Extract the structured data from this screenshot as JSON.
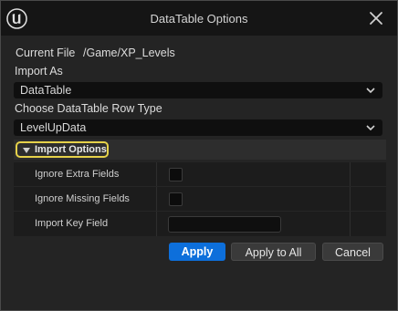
{
  "window": {
    "title": "DataTable Options",
    "icons": {
      "logo": "unreal-engine-logo-icon",
      "close": "close-icon"
    }
  },
  "current_file": {
    "label": "Current File",
    "value": "/Game/XP_Levels"
  },
  "import_as": {
    "label": "Import As",
    "selected": "DataTable"
  },
  "row_type": {
    "label": "Choose DataTable Row Type",
    "selected": "LevelUpData"
  },
  "import_options": {
    "header": "Import Options",
    "expanded": true,
    "properties": [
      {
        "name": "Ignore Extra Fields",
        "type": "checkbox",
        "checked": false
      },
      {
        "name": "Ignore Missing Fields",
        "type": "checkbox",
        "checked": false
      },
      {
        "name": "Import Key Field",
        "type": "text",
        "value": ""
      }
    ]
  },
  "buttons": {
    "apply": "Apply",
    "apply_all": "Apply to All",
    "cancel": "Cancel"
  },
  "colors": {
    "accent_blue": "#0d6fdb",
    "focus_yellow": "#e6d24a",
    "titlebar": "#151515",
    "panel": "#242424"
  }
}
